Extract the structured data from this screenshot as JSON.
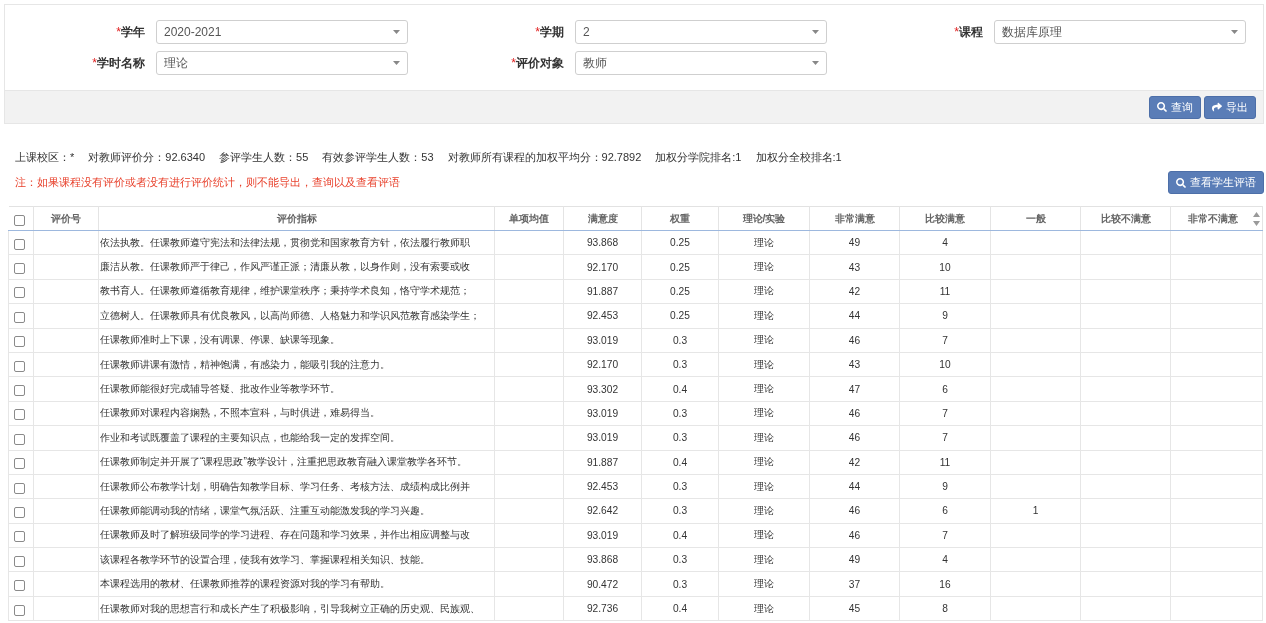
{
  "filters": [
    {
      "mark": "*",
      "label": "学年",
      "value": "2020-2021"
    },
    {
      "mark": "*",
      "label": "学期",
      "value": "2"
    },
    {
      "mark": "*",
      "label": "课程",
      "value": "数据库原理"
    },
    {
      "mark": "*",
      "label": "学时名称",
      "value": "理论"
    },
    {
      "mark": "*",
      "label": "评价对象",
      "value": "教师"
    }
  ],
  "actions": [
    {
      "kind": "search",
      "label": "查询"
    },
    {
      "kind": "export",
      "label": "导出"
    }
  ],
  "summary": [
    "上课校区：*",
    "对教师评价分：92.6340",
    "参评学生人数：55",
    "有效参评学生人数：53",
    "对教师所有课程的加权平均分：92.7892",
    "加权分学院排名:1",
    "加权分全校排名:1"
  ],
  "notice": "注：如果课程没有评价或者没有进行评价统计，则不能导出，查询以及查看评语",
  "comments_button": {
    "kind": "search",
    "label": "查看学生评语"
  },
  "table": {
    "select_all_checked": false,
    "columns": [
      "评价号",
      "评价指标",
      "单项均值",
      "满意度",
      "权重",
      "理论/实验",
      "非常满意",
      "比较满意",
      "一般",
      "比较不满意",
      "非常不满意"
    ],
    "rows": [
      {
        "checked": false,
        "indicator": "依法执教。任课教师遵守宪法和法律法规，贯彻党和国家教育方针，依法履行教师职",
        "satisfaction": "93.868",
        "weight": "0.25",
        "category": "理论",
        "very_satisfied": "49",
        "fairly_satisfied": "4"
      },
      {
        "checked": false,
        "indicator": "廉洁从教。任课教师严于律己，作风严谨正派；清廉从教，以身作则，没有索要或收",
        "satisfaction": "92.170",
        "weight": "0.25",
        "category": "理论",
        "very_satisfied": "43",
        "fairly_satisfied": "10"
      },
      {
        "checked": false,
        "indicator": "教书育人。任课教师遵循教育规律，维护课堂秩序；秉持学术良知，恪守学术规范；",
        "satisfaction": "91.887",
        "weight": "0.25",
        "category": "理论",
        "very_satisfied": "42",
        "fairly_satisfied": "11"
      },
      {
        "checked": false,
        "indicator": "立德树人。任课教师具有优良教风，以高尚师德、人格魅力和学识风范教育感染学生；",
        "satisfaction": "92.453",
        "weight": "0.25",
        "category": "理论",
        "very_satisfied": "44",
        "fairly_satisfied": "9"
      },
      {
        "checked": false,
        "indicator": "任课教师准时上下课，没有调课、停课、缺课等现象。",
        "satisfaction": "93.019",
        "weight": "0.3",
        "category": "理论",
        "very_satisfied": "46",
        "fairly_satisfied": "7"
      },
      {
        "checked": false,
        "indicator": "任课教师讲课有激情，精神饱满，有感染力，能吸引我的注意力。",
        "satisfaction": "92.170",
        "weight": "0.3",
        "category": "理论",
        "very_satisfied": "43",
        "fairly_satisfied": "10"
      },
      {
        "checked": false,
        "indicator": "任课教师能很好完成辅导答疑、批改作业等教学环节。",
        "satisfaction": "93.302",
        "weight": "0.4",
        "category": "理论",
        "very_satisfied": "47",
        "fairly_satisfied": "6"
      },
      {
        "checked": false,
        "indicator": "任课教师对课程内容娴熟，不照本宣科，与时俱进，难易得当。",
        "satisfaction": "93.019",
        "weight": "0.3",
        "category": "理论",
        "very_satisfied": "46",
        "fairly_satisfied": "7"
      },
      {
        "checked": false,
        "indicator": "作业和考试既覆盖了课程的主要知识点，也能给我一定的发挥空间。",
        "satisfaction": "93.019",
        "weight": "0.3",
        "category": "理论",
        "very_satisfied": "46",
        "fairly_satisfied": "7"
      },
      {
        "checked": false,
        "indicator": "任课教师制定并开展了“课程思政”教学设计，注重把思政教育融入课堂教学各环节。",
        "satisfaction": "91.887",
        "weight": "0.4",
        "category": "理论",
        "very_satisfied": "42",
        "fairly_satisfied": "11"
      },
      {
        "checked": false,
        "indicator": "任课教师公布教学计划，明确告知教学目标、学习任务、考核方法、成绩构成比例并",
        "satisfaction": "92.453",
        "weight": "0.3",
        "category": "理论",
        "very_satisfied": "44",
        "fairly_satisfied": "9"
      },
      {
        "checked": false,
        "indicator": "任课教师能调动我的情绪，课堂气氛活跃、注重互动能激发我的学习兴趣。",
        "satisfaction": "92.642",
        "weight": "0.3",
        "category": "理论",
        "very_satisfied": "46",
        "fairly_satisfied": "6",
        "neutral": "1"
      },
      {
        "checked": false,
        "indicator": "任课教师及时了解班级同学的学习进程、存在问题和学习效果，并作出相应调整与改",
        "satisfaction": "93.019",
        "weight": "0.4",
        "category": "理论",
        "very_satisfied": "46",
        "fairly_satisfied": "7"
      },
      {
        "checked": false,
        "indicator": "该课程各教学环节的设置合理，使我有效学习、掌握课程相关知识、技能。",
        "satisfaction": "93.868",
        "weight": "0.3",
        "category": "理论",
        "very_satisfied": "49",
        "fairly_satisfied": "4"
      },
      {
        "checked": false,
        "indicator": "本课程选用的教材、任课教师推荐的课程资源对我的学习有帮助。",
        "satisfaction": "90.472",
        "weight": "0.3",
        "category": "理论",
        "very_satisfied": "37",
        "fairly_satisfied": "16"
      },
      {
        "checked": false,
        "indicator": "任课教师对我的思想言行和成长产生了积极影响，引导我树立正确的历史观、民族观、",
        "satisfaction": "92.736",
        "weight": "0.4",
        "category": "理论",
        "very_satisfied": "45",
        "fairly_satisfied": "8"
      }
    ]
  }
}
